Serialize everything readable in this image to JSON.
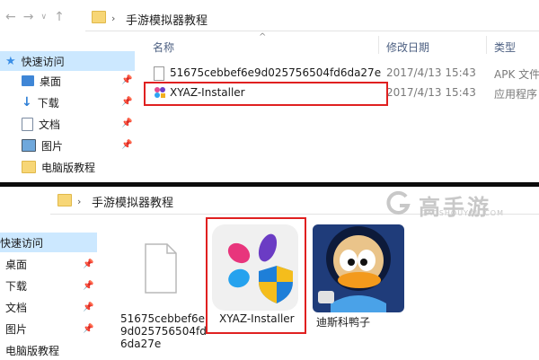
{
  "top": {
    "breadcrumb": "手游模拟器教程",
    "columns": {
      "name": "名称",
      "date": "修改日期",
      "type": "类型"
    },
    "sidebar": [
      {
        "label": "快速访问",
        "icon": "star-icon"
      },
      {
        "label": "桌面",
        "icon": "desktop-icon"
      },
      {
        "label": "下载",
        "icon": "download-icon"
      },
      {
        "label": "文档",
        "icon": "document-icon"
      },
      {
        "label": "图片",
        "icon": "picture-icon"
      },
      {
        "label": "电脑版教程",
        "icon": "folder-icon"
      }
    ],
    "files": [
      {
        "name": "51675cebbef6e9d025756504fd6da27e",
        "date": "2017/4/13 15:43",
        "type": "APK 文件"
      },
      {
        "name": "XYAZ-Installer",
        "date": "2017/4/13 15:43",
        "type": "应用程序"
      }
    ]
  },
  "bottom": {
    "breadcrumb": "手游模拟器教程",
    "sidebar": [
      "快速访问",
      "桌面",
      "下载",
      "文档",
      "图片",
      "电脑版教程"
    ],
    "items": [
      {
        "label_lines": [
          "51675cebbef6e",
          "9d025756504fd",
          "6da27e"
        ]
      },
      {
        "label_lines": [
          "XYAZ-Installer"
        ]
      },
      {
        "label_lines": [
          "迪斯科鸭子"
        ]
      }
    ]
  },
  "watermark": {
    "brand": "高手游",
    "sub": "GAOSHOUYOU.COM"
  },
  "colors": {
    "highlight": "#e02020",
    "selected": "#cce8ff",
    "watermark": "#c8c8c8"
  }
}
